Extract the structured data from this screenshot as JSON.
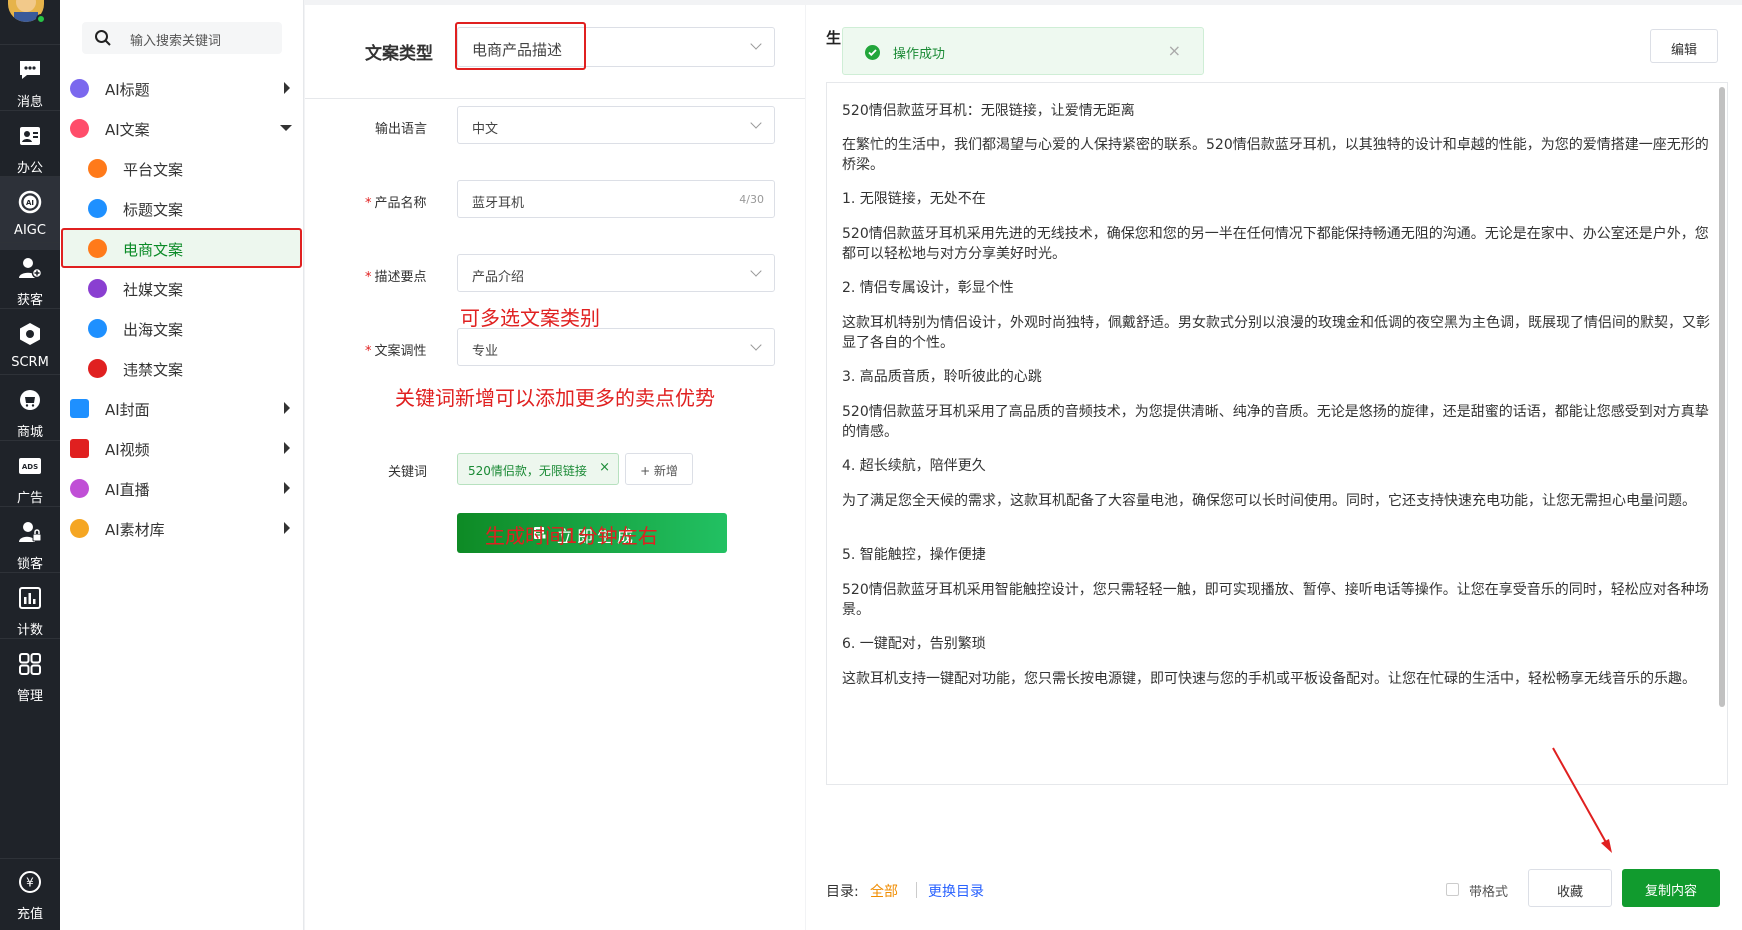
{
  "rail": {
    "items": [
      {
        "label": "消息",
        "icon": "chat-icon"
      },
      {
        "label": "办公",
        "icon": "contact-card-icon"
      },
      {
        "label": "AIGC",
        "icon": "ai-icon"
      },
      {
        "label": "获客",
        "icon": "user-add-icon"
      },
      {
        "label": "SCRM",
        "icon": "hexagon-icon"
      },
      {
        "label": "商城",
        "icon": "store-icon"
      },
      {
        "label": "广告",
        "icon": "ads-icon"
      },
      {
        "label": "锁客",
        "icon": "user-lock-icon"
      },
      {
        "label": "计数",
        "icon": "bar-chart-icon"
      },
      {
        "label": "管理",
        "icon": "grid-icon"
      }
    ],
    "recharge": "充值"
  },
  "menu": {
    "search_placeholder": "输入搜索关键词",
    "items": [
      {
        "label": "AI标题",
        "color": "#7b68ee"
      },
      {
        "label": "AI文案",
        "color": "#ff4d6a"
      },
      {
        "label": "平台文案",
        "color": "#ff7a1a"
      },
      {
        "label": "标题文案",
        "color": "#1e90ff"
      },
      {
        "label": "电商文案",
        "color": "#ff7a1a"
      },
      {
        "label": "社媒文案",
        "color": "#8a3fd1"
      },
      {
        "label": "出海文案",
        "color": "#1e90ff"
      },
      {
        "label": "违禁文案",
        "color": "#e02020"
      },
      {
        "label": "AI封面",
        "color": "#1e90ff"
      },
      {
        "label": "AI视频",
        "color": "#e02020"
      },
      {
        "label": "AI直播",
        "color": "#c04fd6"
      },
      {
        "label": "AI素材库",
        "color": "#f5a623"
      }
    ]
  },
  "form": {
    "type_label": "文案类型",
    "type_value": "电商产品描述",
    "lang_label": "输出语言",
    "lang_value": "中文",
    "name_label": "产品名称",
    "name_value": "蓝牙耳机",
    "name_count": "4/30",
    "points_label": "描述要点",
    "points_value": "产品介绍",
    "tone_label": "文案调性",
    "tone_value": "专业",
    "keyword_label": "关键词",
    "keyword_tag": "520情侣款，无限链接",
    "add_label": "+ 新增",
    "generate_label": "立即生成",
    "annotation_multi": "可多选文案类别",
    "annotation_keywords": "关键词新增可以添加更多的卖点优势",
    "annotation_time": "生成时间1分钟左右"
  },
  "result": {
    "title": "生",
    "toast": "操作成功",
    "edit_label": "编辑",
    "paragraphs": [
      "520情侣款蓝牙耳机：无限链接，让爱情无距离",
      "在繁忙的生活中，我们都渴望与心爱的人保持紧密的联系。520情侣款蓝牙耳机，以其独特的设计和卓越的性能，为您的爱情搭建一座无形的桥梁。",
      "1. 无限链接，无处不在",
      "520情侣款蓝牙耳机采用先进的无线技术，确保您和您的另一半在任何情况下都能保持畅通无阻的沟通。无论是在家中、办公室还是户外，您都可以轻松地与对方分享美好时光。",
      "2. 情侣专属设计，彰显个性",
      "这款耳机特别为情侣设计，外观时尚独特，佩戴舒适。男女款式分别以浪漫的玫瑰金和低调的夜空黑为主色调，既展现了情侣间的默契，又彰显了各自的个性。",
      "3. 高品质音质，聆听彼此的心跳",
      "520情侣款蓝牙耳机采用了高品质的音频技术，为您提供清晰、纯净的音质。无论是悠扬的旋律，还是甜蜜的话语，都能让您感受到对方真挚的情感。",
      "4. 超长续航，陪伴更久",
      "为了满足您全天候的需求，这款耳机配备了大容量电池，确保您可以长时间使用。同时，它还支持快速充电功能，让您无需担心电量问题。",
      "5. 智能触控，操作便捷",
      "520情侣款蓝牙耳机采用智能触控设计，您只需轻轻一触，即可实现播放、暂停、接听电话等操作。让您在享受音乐的同时，轻松应对各种场景。",
      "6. 一键配对，告别繁琐",
      "这款耳机支持一键配对功能，您只需长按电源键，即可快速与您的手机或平板设备配对。让您在忙碌的生活中，轻松畅享无线音乐的乐趣。"
    ],
    "catalog_label": "目录:",
    "catalog_all": "全部",
    "catalog_change": "更换目录",
    "format_label": "带格式",
    "favorite_label": "收藏",
    "copy_label": "复制内容"
  }
}
